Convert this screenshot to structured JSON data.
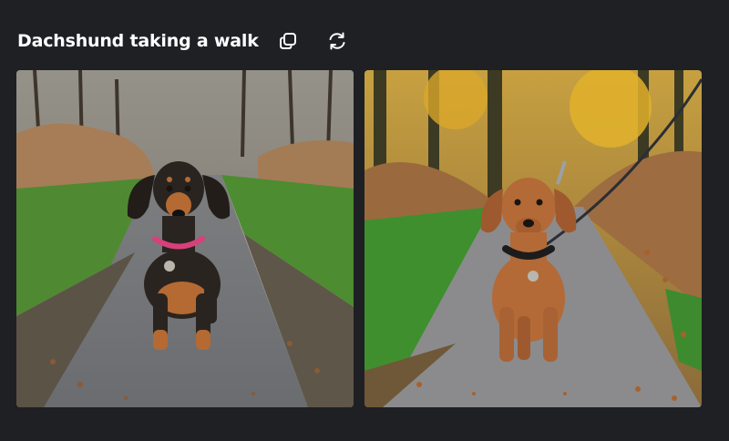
{
  "header": {
    "title": "Dachshund taking a walk",
    "copy_icon": "copy-icon",
    "regenerate_icon": "refresh-icon"
  },
  "images": [
    {
      "subject": "black and tan dachshund with pink collar walking on a park path",
      "colors": {
        "dog": "#2a2420",
        "tan": "#b46a32",
        "collar": "#d8407a",
        "grass": "#4e8a32",
        "path": "#8c8e92"
      }
    },
    {
      "subject": "red dachshund on a leash walking on an autumn path",
      "colors": {
        "dog": "#b36a36",
        "collar": "#1c1c1c",
        "grass": "#3f8f2e",
        "foliage": "#d8a22a",
        "path": "#8b8b8d"
      }
    }
  ],
  "theme": {
    "background": "#1f2024",
    "text": "#ffffff"
  }
}
